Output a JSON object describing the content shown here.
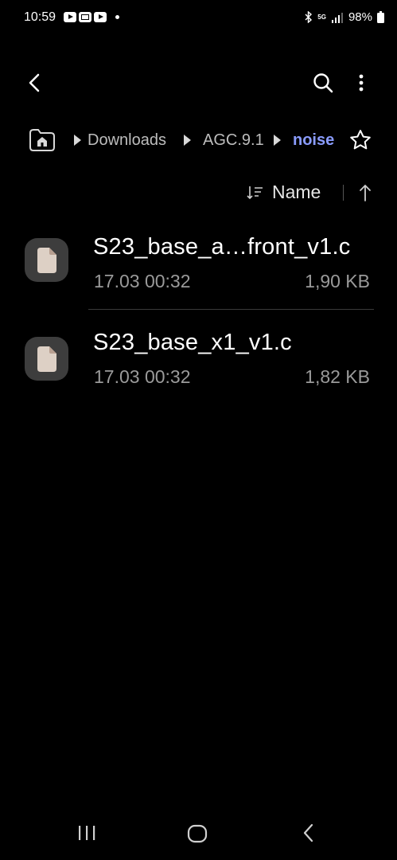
{
  "status_bar": {
    "time": "10:59",
    "network": "5G",
    "battery": "98%",
    "notification_icons": [
      "youtube-icon",
      "gallery-icon",
      "youtube-icon"
    ]
  },
  "toolbar": {
    "back_icon": "chevron-left-icon",
    "search_icon": "search-icon",
    "more_icon": "more-vertical-icon"
  },
  "breadcrumb": {
    "items": [
      "Downloads",
      "AGC.9.1",
      "noise"
    ],
    "home_icon": "home-icon",
    "favorite_icon": "star-outline-icon"
  },
  "sort": {
    "label": "Name",
    "direction": "ascending"
  },
  "files": [
    {
      "name": "S23_base_a…front_v1.c",
      "date": "17.03 00:32",
      "size": "1,90 KB"
    },
    {
      "name": "S23_base_x1_v1.c",
      "date": "17.03 00:32",
      "size": "1,82 KB"
    }
  ],
  "colors": {
    "background": "#000000",
    "accent": "#8a9cff",
    "secondary_text": "#9a9a9a"
  }
}
